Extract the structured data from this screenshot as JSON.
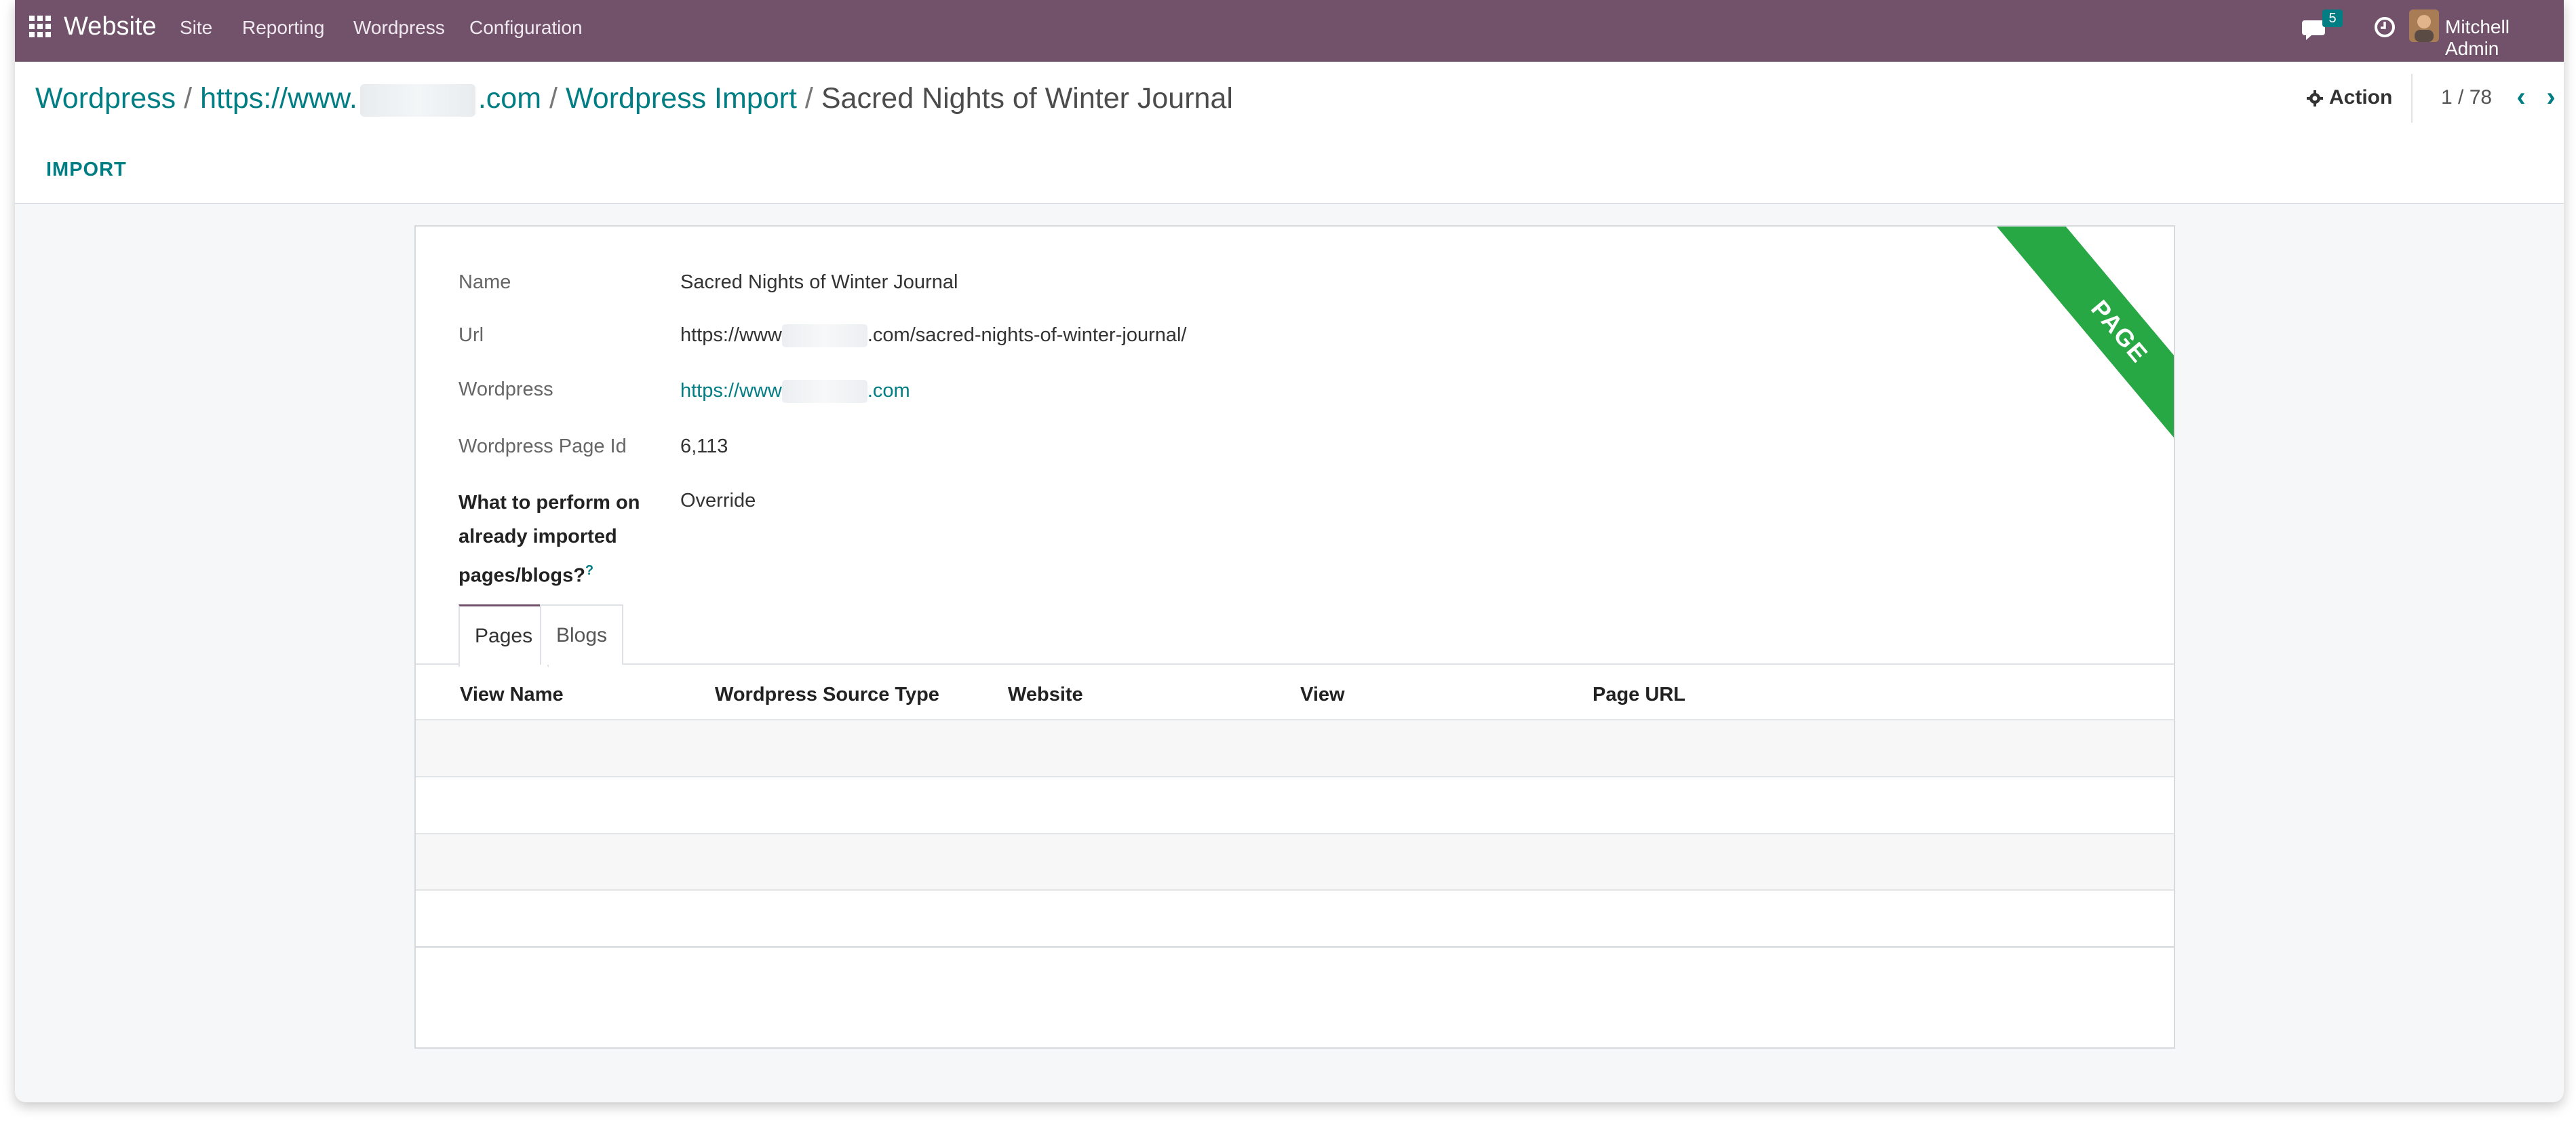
{
  "navbar": {
    "app_name": "Website",
    "menu": [
      "Site",
      "Reporting",
      "Wordpress",
      "Configuration"
    ],
    "chat_count": "5",
    "user_name": "Mitchell Admin"
  },
  "breadcrumb": {
    "items": [
      "Wordpress",
      "https://www.",
      ".com",
      "Wordpress Import"
    ],
    "current": "Sacred Nights of Winter Journal"
  },
  "toolbar": {
    "action_label": "Action",
    "pager": "1 / 78",
    "import_label": "IMPORT"
  },
  "ribbon": {
    "label": "PAGE",
    "color": "#28a745"
  },
  "form": {
    "fields": [
      {
        "label": "Name",
        "value": "Sacred Nights of Winter Journal"
      },
      {
        "label": "Url",
        "value_prefix": "https://www",
        "value_suffix": ".com/sacred-nights-of-winter-journal/"
      },
      {
        "label": "Wordpress",
        "value_prefix": "https://www",
        "value_suffix": ".com"
      },
      {
        "label": "Wordpress Page Id",
        "value": "6,113"
      },
      {
        "label": "What to perform on already imported pages/blogs?",
        "help": "?",
        "value": "Override"
      }
    ]
  },
  "tabs": [
    {
      "label": "Pages",
      "active": true
    },
    {
      "label": "Blogs",
      "active": false
    }
  ],
  "table": {
    "columns": [
      "View Name",
      "Wordpress Source Type",
      "Website",
      "View",
      "Page URL"
    ],
    "rows": []
  },
  "colors": {
    "navbar": "#71526a",
    "accent": "#017e84"
  }
}
